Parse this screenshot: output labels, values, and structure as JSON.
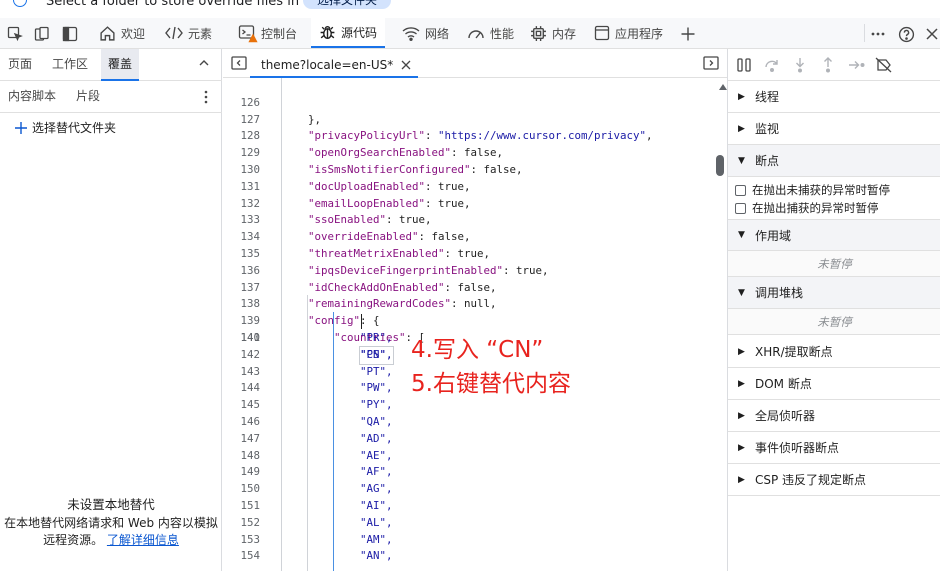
{
  "infobar": {
    "message": "Select a folder to store override files in",
    "button_label": "选择文件夹"
  },
  "toolbar": {
    "tabs": [
      {
        "label": "欢迎",
        "icon": "home-icon"
      },
      {
        "label": "元素",
        "icon": "code-brackets-icon"
      },
      {
        "label": "控制台",
        "icon": "console-icon"
      },
      {
        "label": "源代码",
        "icon": "bug-icon"
      },
      {
        "label": "网络",
        "icon": "wifi-icon"
      },
      {
        "label": "性能",
        "icon": "performance-icon"
      },
      {
        "label": "内存",
        "icon": "memory-chip-icon"
      },
      {
        "label": "应用程序",
        "icon": "application-icon"
      }
    ],
    "active_tab": "源代码",
    "accent_color": "#1a73e8",
    "warning_color": "#e8710a"
  },
  "left_panel": {
    "tabs": [
      "页面",
      "工作区",
      "覆盖"
    ],
    "active_tab": "覆盖",
    "subtabs": [
      "内容脚本",
      "片段"
    ],
    "add_folder_label": "选择替代文件夹",
    "empty_title": "未设置本地替代",
    "empty_desc": "在本地替代网络请求和 Web 内容以模拟远程资源。",
    "learn_more": "了解详细信息"
  },
  "editor": {
    "file_tab": "theme?locale=en-US*",
    "lines": [
      {
        "n": "126",
        "text": "},"
      },
      {
        "n": "127",
        "key": "\"privacyPolicyUrl\"",
        "val": "\"https://www.cursor.com/privacy\"",
        "tail": ","
      },
      {
        "n": "128",
        "key": "\"openOrgSearchEnabled\"",
        "val": "false",
        "tail": ","
      },
      {
        "n": "129",
        "key": "\"isSmsNotifierConfigured\"",
        "val": "false",
        "tail": ","
      },
      {
        "n": "130",
        "key": "\"docUploadEnabled\"",
        "val": "true",
        "tail": ","
      },
      {
        "n": "131",
        "key": "\"emailLoopEnabled\"",
        "val": "true",
        "tail": ","
      },
      {
        "n": "132",
        "key": "\"ssoEnabled\"",
        "val": "true",
        "tail": ","
      },
      {
        "n": "133",
        "key": "\"overrideEnabled\"",
        "val": "false",
        "tail": ","
      },
      {
        "n": "134",
        "key": "\"threatMetrixEnabled\"",
        "val": "true",
        "tail": ","
      },
      {
        "n": "135",
        "key": "\"ipqsDeviceFingerprintEnabled\"",
        "val": "true",
        "tail": ","
      },
      {
        "n": "136",
        "key": "\"idCheckAddOnEnabled\"",
        "val": "false",
        "tail": ","
      },
      {
        "n": "137",
        "key": "\"remainingRewardCodes\"",
        "val": "null",
        "tail": ","
      },
      {
        "n": "138",
        "key": "\"config\"",
        "val": "{",
        "tail": ""
      },
      {
        "n": "139",
        "key": "\"countries\"",
        "val": "[",
        "tail": ""
      },
      {
        "n": "140",
        "text": "\"CN\","
      },
      {
        "n": "141",
        "text": "\"PR\","
      },
      {
        "n": "142",
        "text": "\"PS\","
      },
      {
        "n": "143",
        "text": "\"PT\","
      },
      {
        "n": "144",
        "text": "\"PW\","
      },
      {
        "n": "145",
        "text": "\"PY\","
      },
      {
        "n": "146",
        "text": "\"QA\","
      },
      {
        "n": "147",
        "text": "\"AD\","
      },
      {
        "n": "148",
        "text": "\"AE\","
      },
      {
        "n": "149",
        "text": "\"AF\","
      },
      {
        "n": "150",
        "text": "\"AG\","
      },
      {
        "n": "151",
        "text": "\"AI\","
      },
      {
        "n": "152",
        "text": "\"AL\","
      },
      {
        "n": "153",
        "text": "\"AM\","
      },
      {
        "n": "154",
        "text": "\"AN\","
      }
    ],
    "annotation_line1": "4.写入 “CN”",
    "annotation_line2": "5.右键替代内容"
  },
  "debugger": {
    "sections_top": [
      "线程",
      "监视",
      "断点"
    ],
    "breakpoint_options": [
      "在抛出未捕获的异常时暂停",
      "在抛出捕获的异常时暂停"
    ],
    "scope_label": "作用域",
    "not_paused": "未暂停",
    "callstack_label": "调用堆栈",
    "sections_bottom": [
      "XHR/提取断点",
      "DOM 断点",
      "全局侦听器",
      "事件侦听器断点",
      "CSP 违反了规定断点"
    ]
  }
}
